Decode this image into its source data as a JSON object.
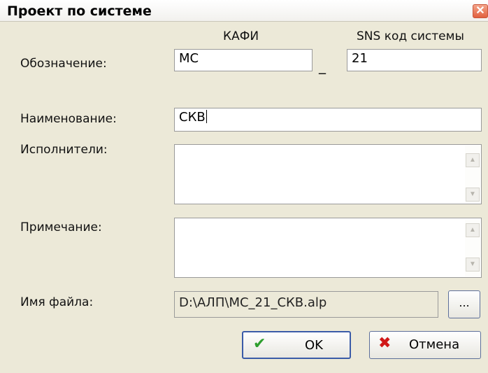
{
  "window": {
    "title": "Проект по системе",
    "close_glyph": "✕"
  },
  "columns": {
    "kafi": "КАФИ",
    "sns": "SNS код системы"
  },
  "labels": {
    "designation": "Обозначение:",
    "name": "Наименование:",
    "executors": "Исполнители:",
    "note": "Примечание:",
    "filename": "Имя файла:"
  },
  "fields": {
    "kafi_value": "МС",
    "separator": "_",
    "sns_value": "21",
    "name_value": "СКВ",
    "executors_value": "",
    "note_value": "",
    "filename_value": "D:\\АЛП\\МС_21_СКВ.alp"
  },
  "buttons": {
    "browse": "...",
    "ok": "OK",
    "ok_icon": "✔",
    "cancel": "Отмена",
    "cancel_icon": "✖"
  },
  "colors": {
    "ok_icon": "#2e9e2e",
    "cancel_icon": "#d01818"
  }
}
